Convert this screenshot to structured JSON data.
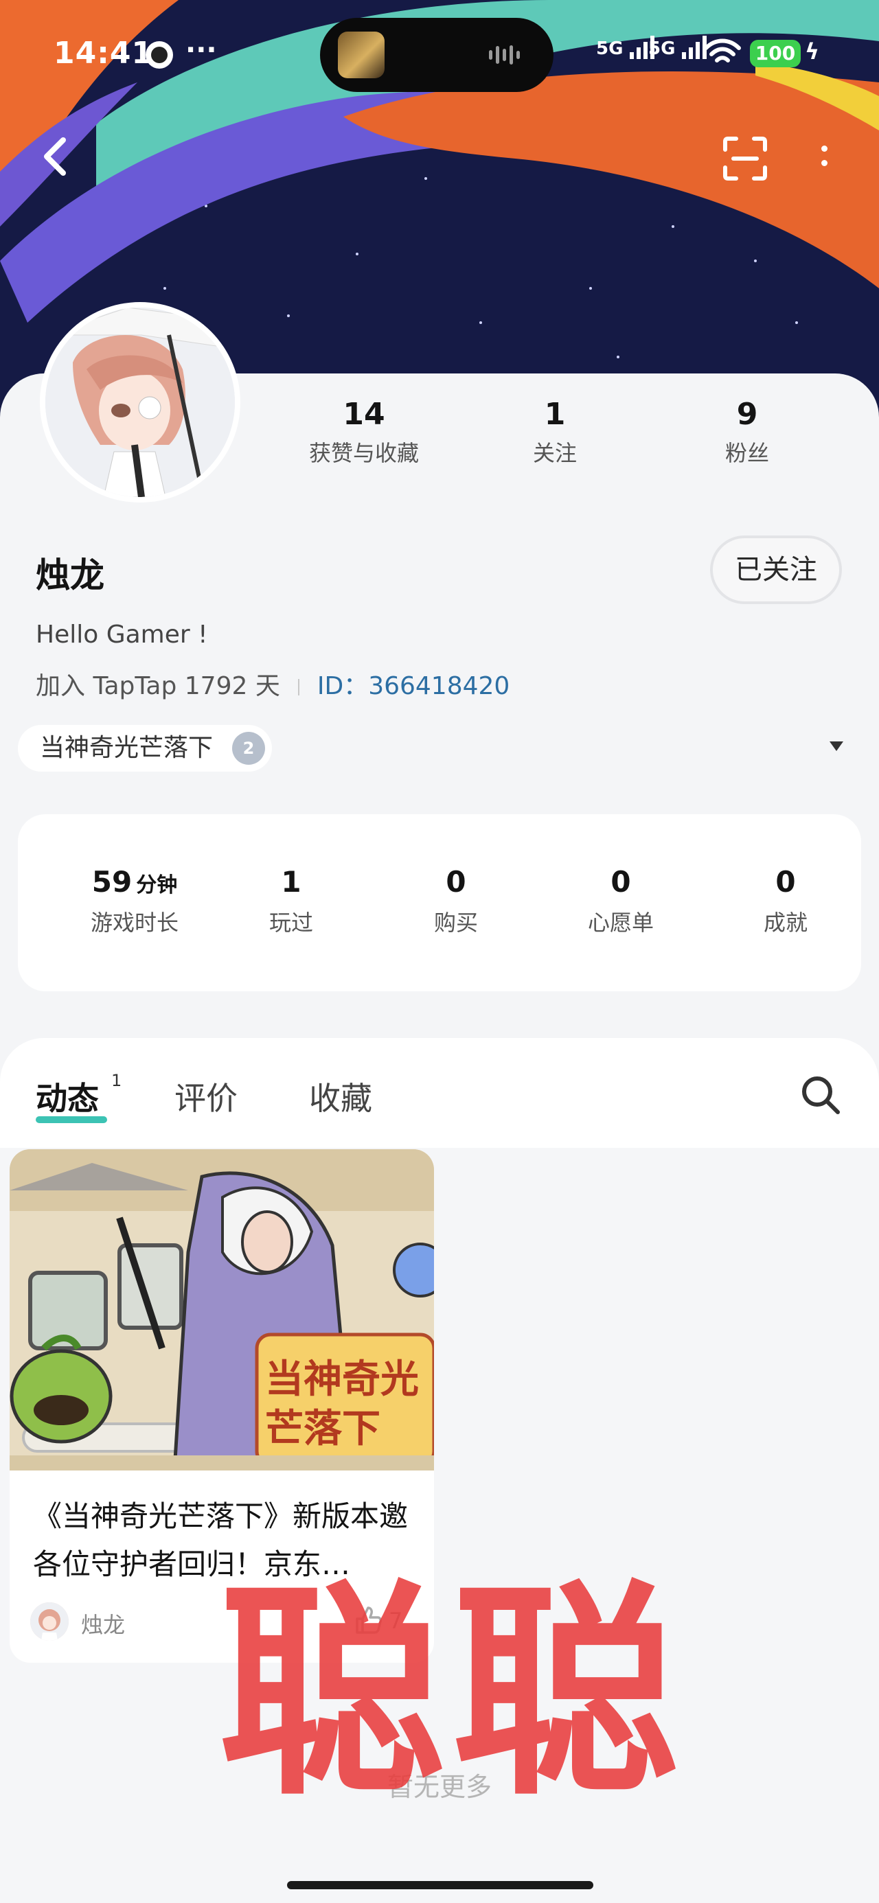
{
  "status_bar": {
    "time": "14:41",
    "more": "···",
    "signal_1": "5G",
    "signal_2": "5G",
    "battery": "100",
    "charging_icon": "bolt-icon"
  },
  "header": {
    "back_icon": "back-arrow-icon",
    "scan_icon": "scan-icon",
    "menu_icon": "more-vertical-icon"
  },
  "profile": {
    "username": "烛龙",
    "follow_label": "已关注",
    "bio": "Hello Gamer !",
    "joined_text": "加入 TapTap 1792 天",
    "id_label": "ID：",
    "id_value": "366418420",
    "stats": [
      {
        "value": "14",
        "label": "获赞与收藏"
      },
      {
        "value": "1",
        "label": "关注"
      },
      {
        "value": "9",
        "label": "粉丝"
      }
    ],
    "game_chip": {
      "label": "当神奇光芒落下",
      "badge": "2"
    }
  },
  "game_stats": [
    {
      "value": "59",
      "unit": "分钟",
      "label": "游戏时长"
    },
    {
      "value": "1",
      "unit": "",
      "label": "玩过"
    },
    {
      "value": "0",
      "unit": "",
      "label": "购买"
    },
    {
      "value": "0",
      "unit": "",
      "label": "心愿单"
    },
    {
      "value": "0",
      "unit": "",
      "label": "成就"
    }
  ],
  "tabs": [
    {
      "label": "动态",
      "count": "1",
      "active": true
    },
    {
      "label": "评价",
      "active": false
    },
    {
      "label": "收藏",
      "active": false
    }
  ],
  "post": {
    "title": "《当神奇光芒落下》新版本邀各位守护者回归！京东…",
    "image_banner_text": "当神奇光芒落下",
    "author": "烛龙",
    "likes": "7"
  },
  "footer": {
    "no_more": "暂无更多"
  },
  "watermark": "聪聪",
  "colors": {
    "accent_teal": "#3cc3b4",
    "id_blue": "#2c6ea3",
    "battery_green": "#3ccf4e",
    "watermark_red": "#e83c3c"
  }
}
